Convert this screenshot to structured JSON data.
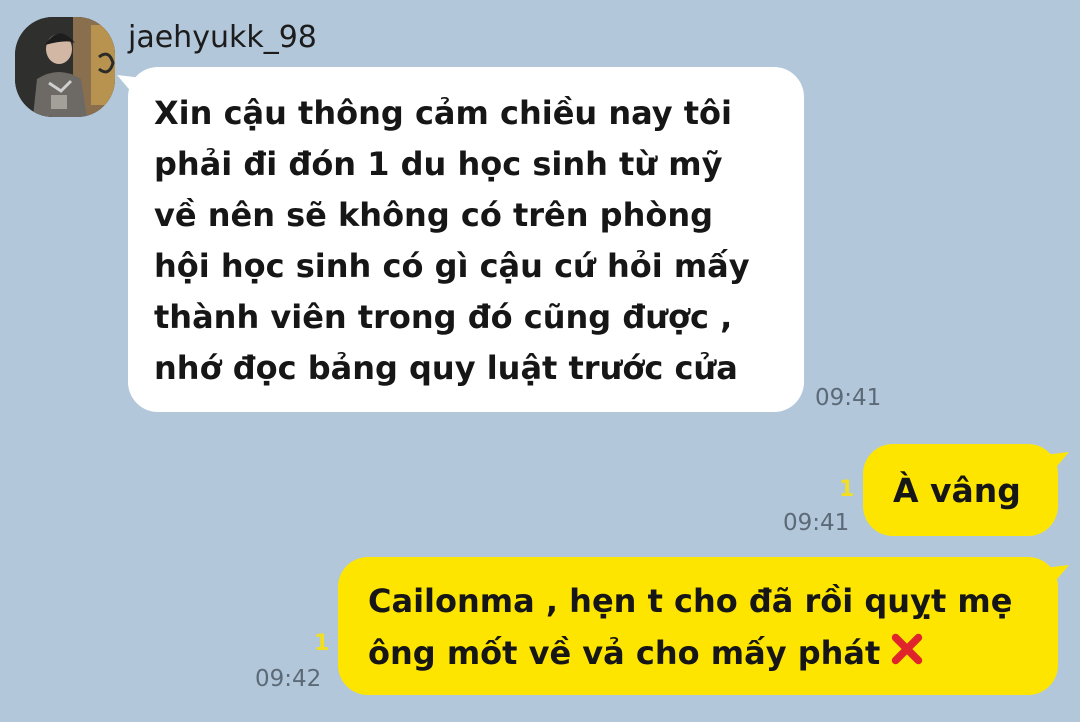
{
  "contact": {
    "name": "jaehyukk_98",
    "avatar_icon": "profile-photo"
  },
  "messages": [
    {
      "direction": "incoming",
      "lines": [
        "Xin cậu thông cảm chiều nay tôi",
        "phải đi đón 1 du học sinh từ mỹ",
        "về nên sẽ không có trên phòng",
        "hội học sinh có gì cậu cứ hỏi mấy",
        "thành viên trong đó cũng được ,",
        "nhớ đọc bảng quy luật trước cửa"
      ],
      "time": "09:41"
    },
    {
      "direction": "outgoing",
      "lines": [
        "À vâng"
      ],
      "time": "09:41",
      "unread": "1"
    },
    {
      "direction": "outgoing",
      "lines": [
        "Cailonma , hẹn t cho đã rồi quỵt mẹ",
        "ông mốt về vả cho mấy phát"
      ],
      "emoji": "cross-mark-icon",
      "time": "09:42",
      "unread": "1"
    }
  ],
  "colors": {
    "background": "#b2c7da",
    "incoming_bubble": "#ffffff",
    "outgoing_bubble": "#fee500",
    "unread_count": "#f2de22",
    "timestamp": "#5c6a78",
    "cross_mark": "#e0242c"
  }
}
